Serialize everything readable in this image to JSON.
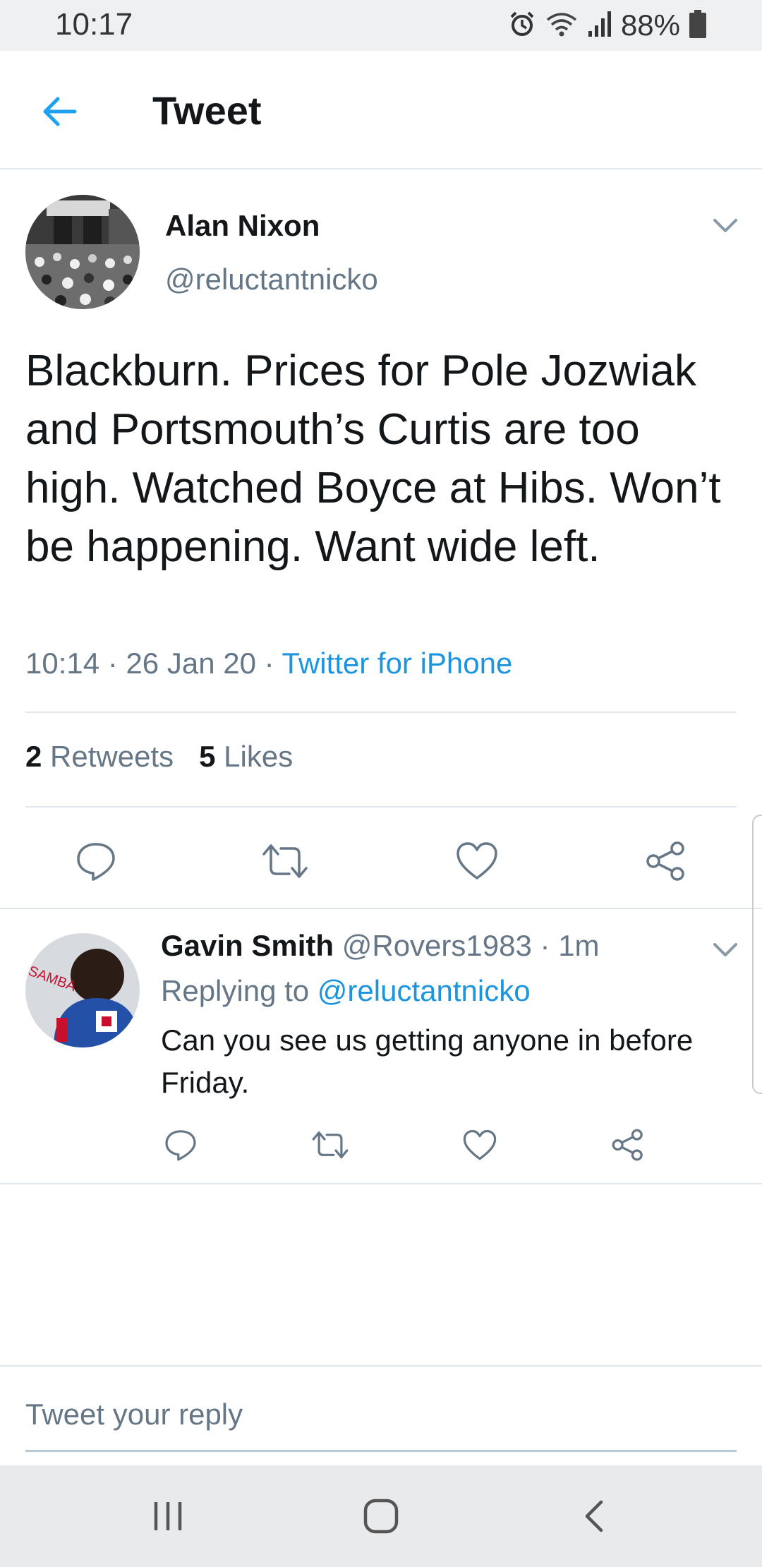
{
  "status_bar": {
    "time": "10:17",
    "battery": "88%",
    "icons": [
      "alarm-icon",
      "wifi-icon",
      "signal-icon",
      "battery-icon"
    ]
  },
  "header": {
    "title": "Tweet",
    "back_icon": "back-arrow-icon"
  },
  "tweet": {
    "author_name": "Alan Nixon",
    "author_handle": "@reluctantnicko",
    "text": "Blackburn. Prices for Pole Jozwiak and Portsmouth’s Curtis are too high. Watched Boyce at Hibs. Won’t be happening. Want wide left.",
    "time": "10:14",
    "date": "26 Jan 20",
    "separator": "·",
    "source": "Twitter for iPhone",
    "retweets_count": "2",
    "retweets_label": "Retweets",
    "likes_count": "5",
    "likes_label": "Likes"
  },
  "reply": {
    "author_name": "Gavin Smith",
    "author_handle": "@Rovers1983",
    "age": "1m",
    "replying_to_label": "Replying to",
    "replying_to_handle": "@reluctantnicko",
    "text": "Can you see us getting anyone in before Friday."
  },
  "compose": {
    "placeholder": "Tweet your reply"
  },
  "colors": {
    "accent": "#1b95e0",
    "text": "#14171a",
    "muted": "#657786",
    "border": "#e1e8ed"
  },
  "actions": [
    "reply-icon",
    "retweet-icon",
    "like-icon",
    "share-icon"
  ],
  "nav_bar": [
    "recent-apps-icon",
    "home-icon",
    "back-icon"
  ]
}
